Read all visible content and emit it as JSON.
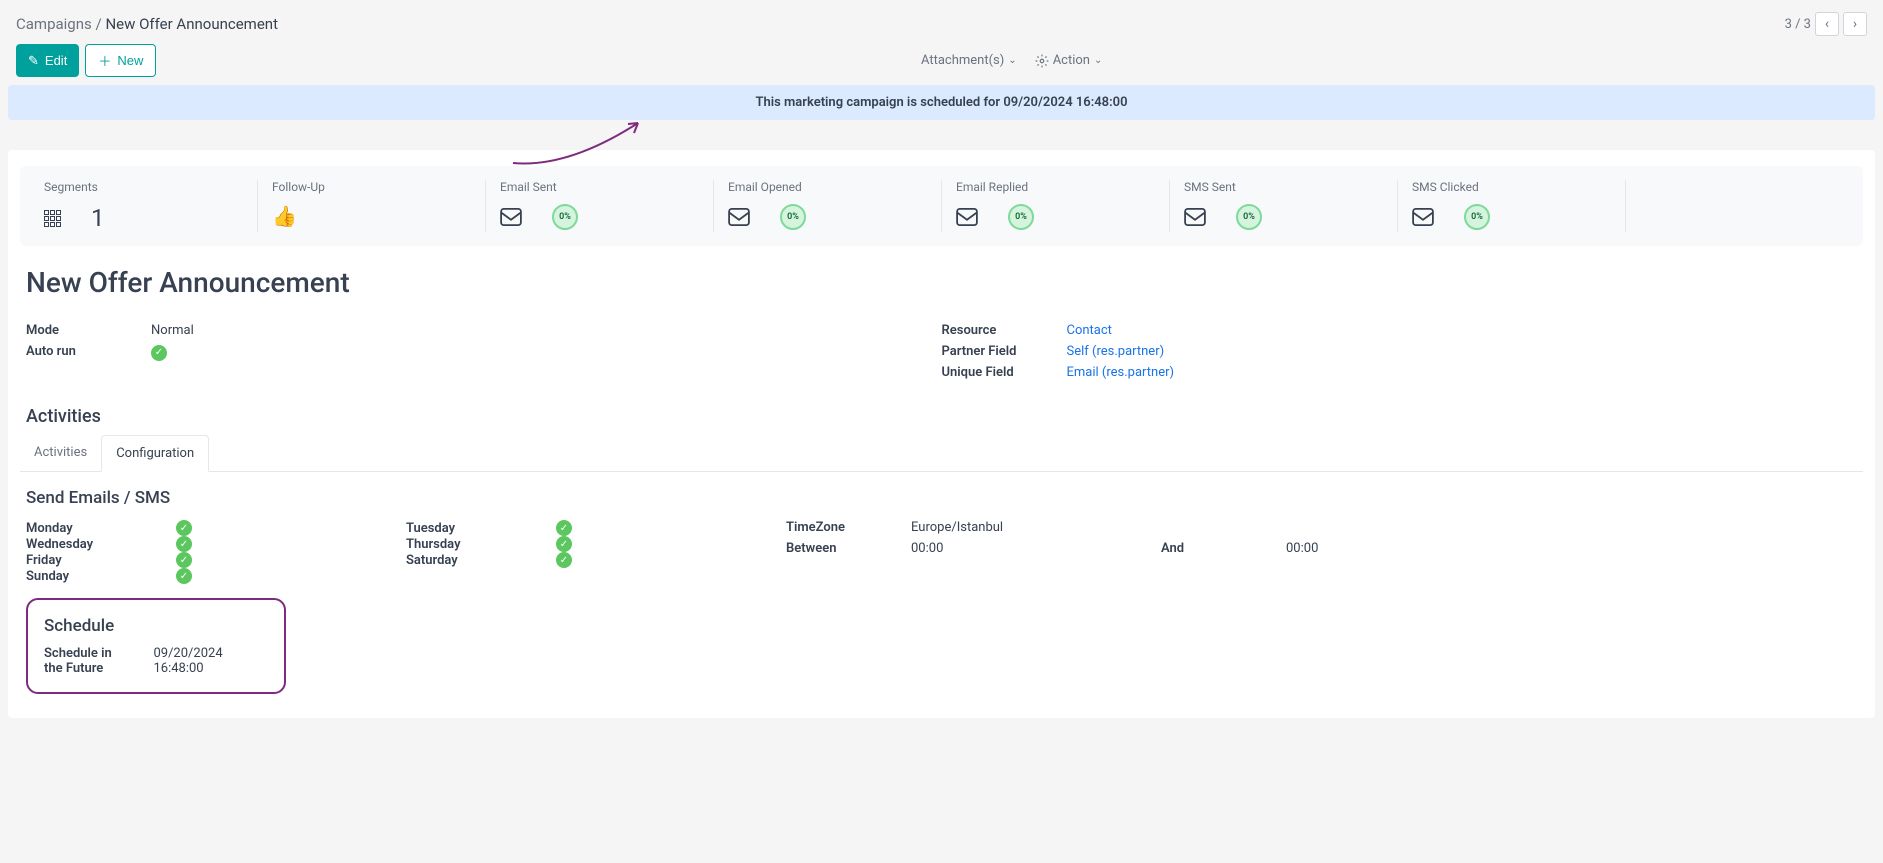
{
  "breadcrumb": {
    "root": "Campaigns",
    "sep": "/",
    "current": "New Offer Announcement"
  },
  "pager": {
    "text": "3 / 3"
  },
  "toolbar": {
    "edit": "Edit",
    "new": "New",
    "attachments": "Attachment(s)",
    "action": "Action"
  },
  "banner": "This marketing campaign is scheduled for 09/20/2024 16:48:00",
  "stats": {
    "segments": {
      "label": "Segments",
      "count": "1"
    },
    "followup": {
      "label": "Follow-Up"
    },
    "email_sent": {
      "label": "Email Sent",
      "pct": "0%"
    },
    "email_opened": {
      "label": "Email Opened",
      "pct": "0%"
    },
    "email_replied": {
      "label": "Email Replied",
      "pct": "0%"
    },
    "sms_sent": {
      "label": "SMS Sent",
      "pct": "0%"
    },
    "sms_clicked": {
      "label": "SMS Clicked",
      "pct": "0%"
    }
  },
  "title": "New Offer Announcement",
  "fields": {
    "mode": {
      "label": "Mode",
      "value": "Normal"
    },
    "autorun": {
      "label": "Auto run"
    },
    "resource": {
      "label": "Resource",
      "value": "Contact"
    },
    "partner": {
      "label": "Partner Field",
      "value": "Self (res.partner)"
    },
    "unique": {
      "label": "Unique Field",
      "value": "Email (res.partner)"
    }
  },
  "activities_heading": "Activities",
  "tabs": {
    "activities": "Activities",
    "configuration": "Configuration"
  },
  "config": {
    "send_title": "Send Emails / SMS",
    "days": {
      "mon": "Monday",
      "tue": "Tuesday",
      "wed": "Wednesday",
      "thu": "Thursday",
      "fri": "Friday",
      "sat": "Saturday",
      "sun": "Sunday"
    },
    "tz": {
      "label": "TimeZone",
      "value": "Europe/Istanbul"
    },
    "between": {
      "label": "Between",
      "from": "00:00",
      "and": "And",
      "to": "00:00"
    },
    "schedule": {
      "title": "Schedule",
      "label": "Schedule in the Future",
      "value": "09/20/2024 16:48:00"
    }
  }
}
